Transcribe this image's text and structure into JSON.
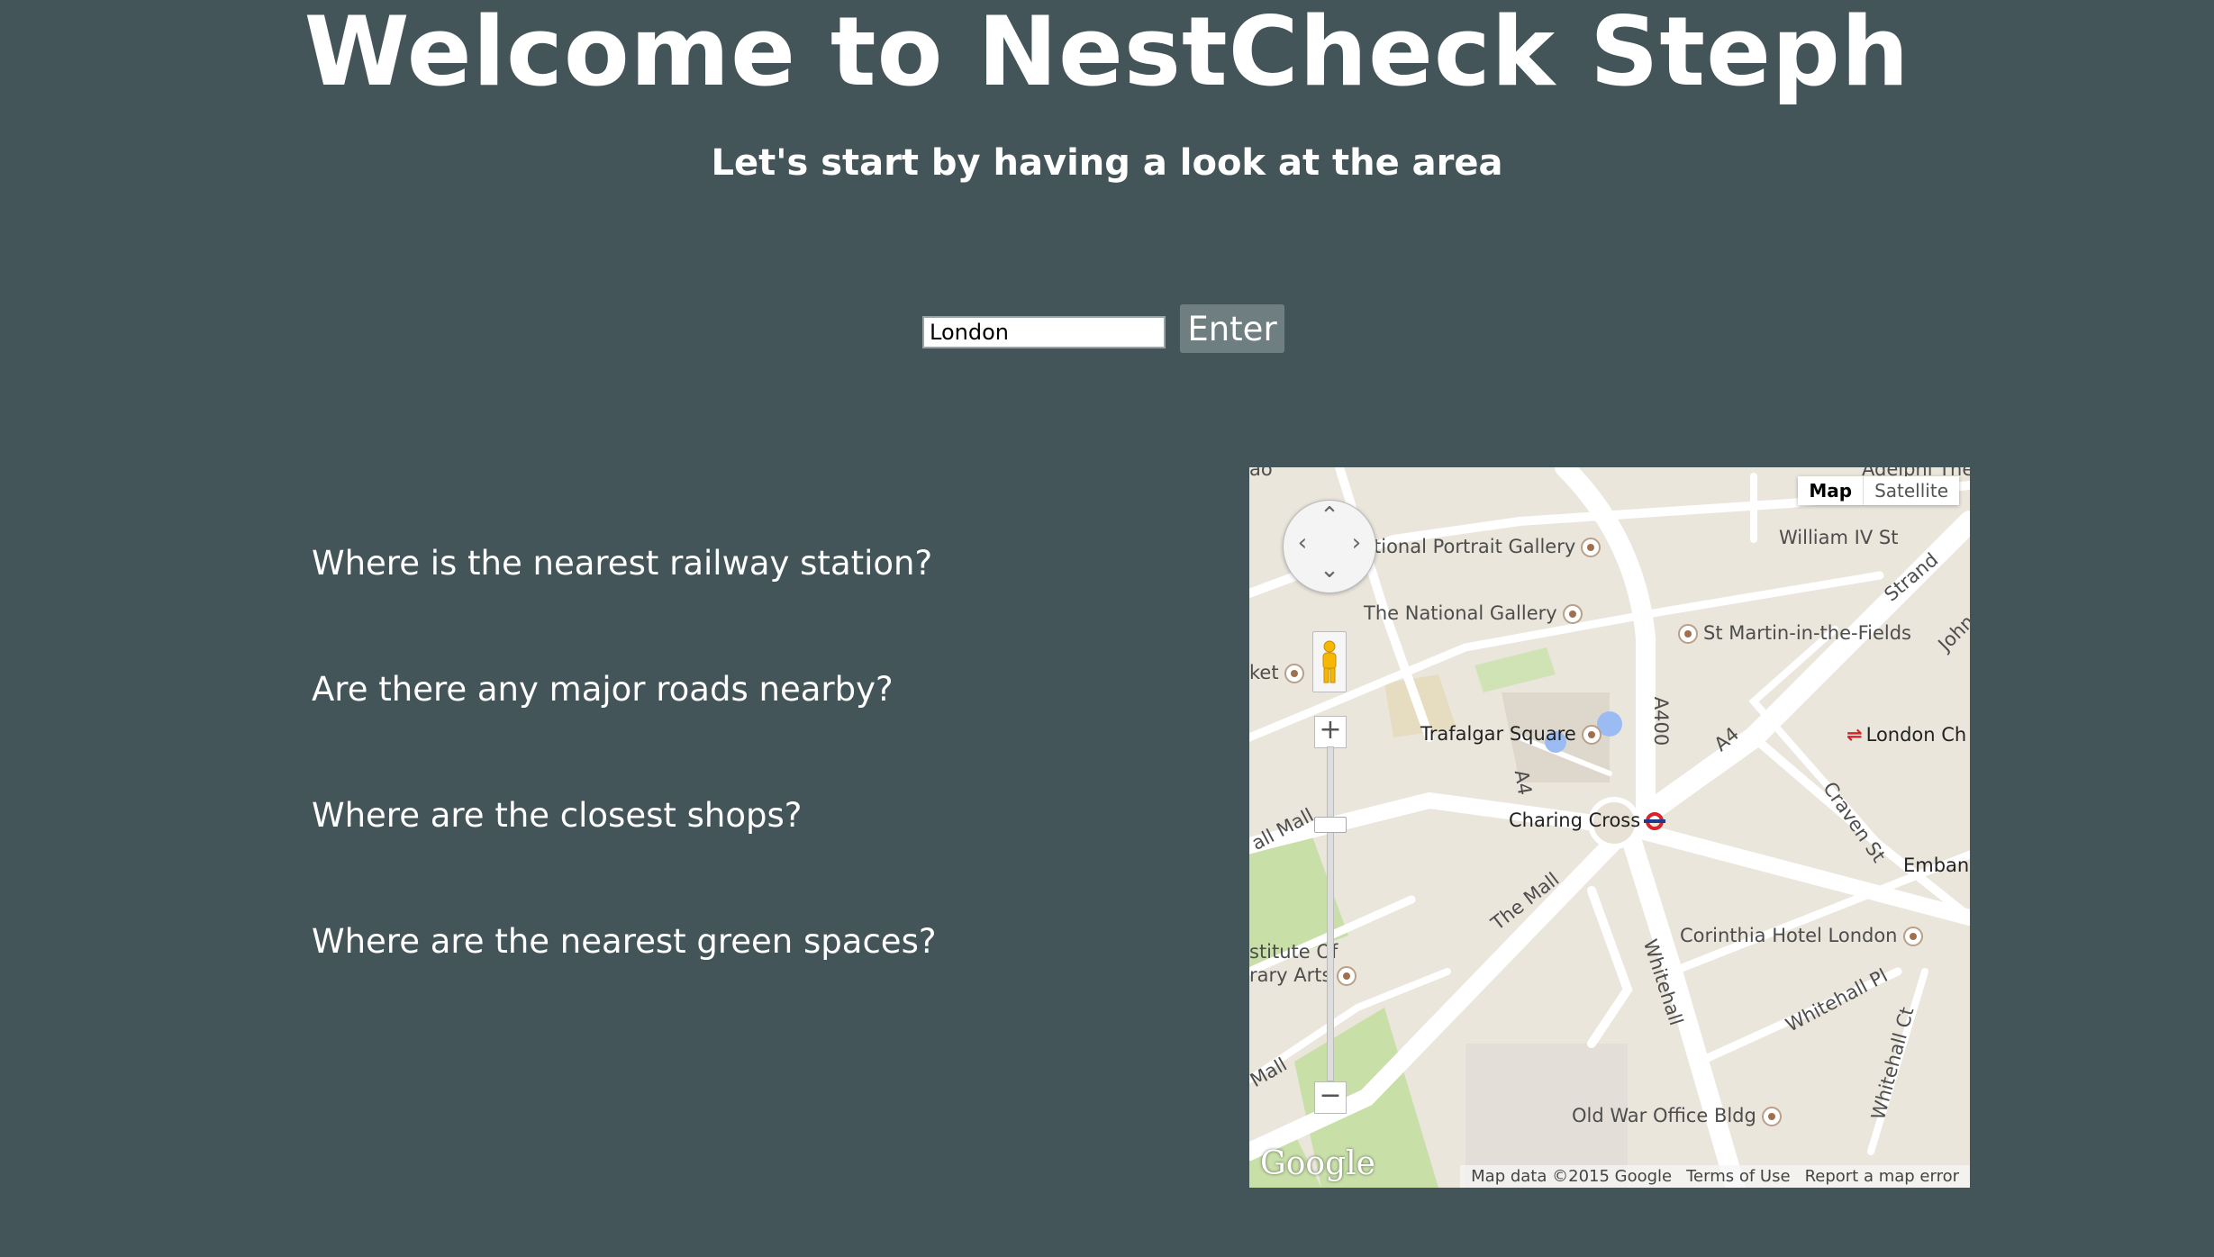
{
  "header": {
    "title": "Welcome to NestCheck Steph",
    "subtitle": "Let's start by having a look at the area"
  },
  "search": {
    "value": "London",
    "enter_label": "Enter"
  },
  "questions": [
    "Where is the nearest railway station?",
    "Are there any major roads nearby?",
    "Where are the closest shops?",
    "Where are the nearest green spaces?"
  ],
  "map": {
    "type_controls": {
      "map_label": "Map",
      "satellite_label": "Satellite"
    },
    "labels": {
      "adelphi": "Adelphi The",
      "portrait_gallery": "tional Portrait Gallery",
      "national_gallery": "The National Gallery",
      "william_iv": "William IV St",
      "strand": "Strand",
      "st_martin": "St Martin-in-the-Fields",
      "john": "John",
      "ket": "ket",
      "a400": "A400",
      "trafalgar": "Trafalgar Square",
      "a4_right": "A4",
      "london_ch": "London Ch",
      "a4_left": "A4",
      "mall_top": "all Mall",
      "charing_cross": "Charing Cross",
      "craven": "Craven St",
      "embank": "Embank",
      "the_mall": "The Mall",
      "corinthia": "Corinthia Hotel London",
      "institute_1": "stitute Of",
      "institute_2": "rary Arts",
      "whitehall": "Whitehall",
      "whitehall_pl": "Whitehall Pl",
      "whitehall_ct": "Whitehall Ct",
      "mall_bottom": "Mall",
      "old_war_office": "Old War Office Bldg",
      "ao": "ao"
    },
    "zoom_in": "+",
    "zoom_out": "−",
    "google_logo": "Google",
    "attribution": {
      "data": "Map data ©2015 Google",
      "terms": "Terms of Use",
      "report": "Report a map error"
    },
    "colors": {
      "land": "#ebe6dc",
      "road": "#ffffff",
      "park": "#c8dfa8",
      "underground": "#d8232a"
    }
  }
}
